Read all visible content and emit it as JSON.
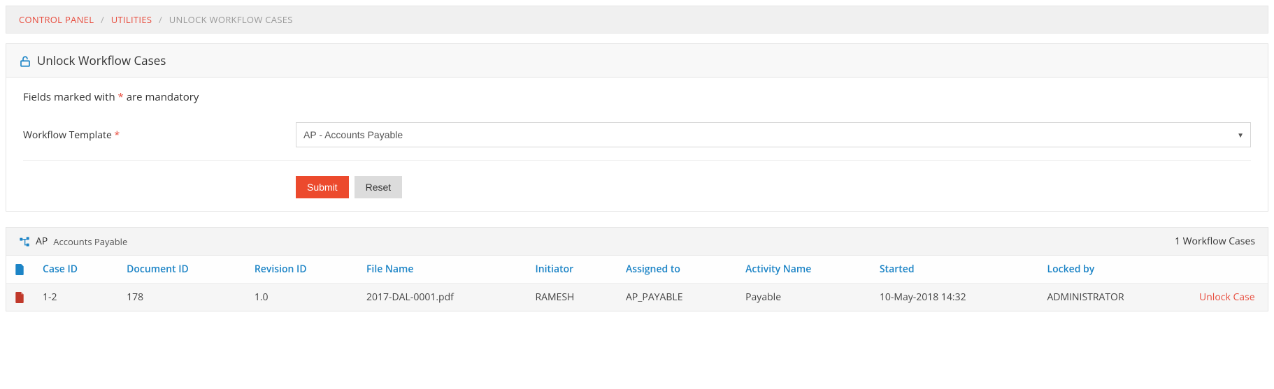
{
  "breadcrumb": {
    "items": [
      {
        "label": "CONTROL PANEL",
        "active": false
      },
      {
        "label": "UTILITIES",
        "active": false
      },
      {
        "label": "UNLOCK WORKFLOW CASES",
        "active": true
      }
    ]
  },
  "panel": {
    "title": "Unlock Workflow Cases",
    "mandatory_note_pre": "Fields marked with ",
    "mandatory_note_ast": "*",
    "mandatory_note_post": " are mandatory"
  },
  "form": {
    "workflow_template_label": "Workflow Template ",
    "workflow_template_req": "*",
    "workflow_template_value": "AP - Accounts Payable",
    "submit_label": "Submit",
    "reset_label": "Reset"
  },
  "results": {
    "header_code": "AP",
    "header_name": "Accounts Payable",
    "count_text": "1 Workflow Cases",
    "columns": {
      "case_id": "Case ID",
      "document_id": "Document ID",
      "revision_id": "Revision ID",
      "file_name": "File Name",
      "initiator": "Initiator",
      "assigned_to": "Assigned to",
      "activity_name": "Activity Name",
      "started": "Started",
      "locked_by": "Locked by"
    },
    "rows": [
      {
        "case_id": "1-2",
        "document_id": "178",
        "revision_id": "1.0",
        "file_name": "2017-DAL-0001.pdf",
        "initiator": "RAMESH",
        "assigned_to": "AP_PAYABLE",
        "activity_name": "Payable",
        "started": "10-May-2018 14:32",
        "locked_by": "ADMINISTRATOR",
        "action": "Unlock Case"
      }
    ]
  }
}
